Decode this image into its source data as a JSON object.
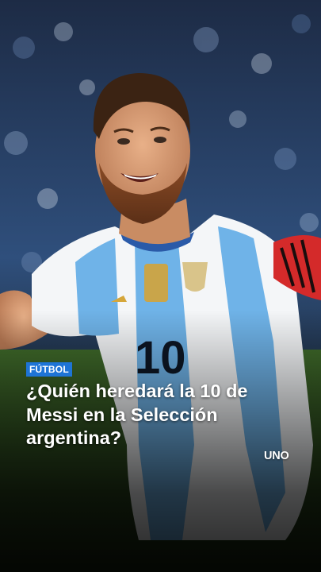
{
  "story": {
    "category": "FÚTBOL",
    "headline": "¿Quién heredará la 10 de Messi en la Selección argentina?",
    "brand_logo": "UNO",
    "jersey_number": "10"
  },
  "colors": {
    "badge_bg": "#1e74d6",
    "jersey_sky_blue": "#6fb3e8",
    "jersey_white": "#f4f6f8",
    "armband": "#d42a2a",
    "text": "#ffffff"
  }
}
